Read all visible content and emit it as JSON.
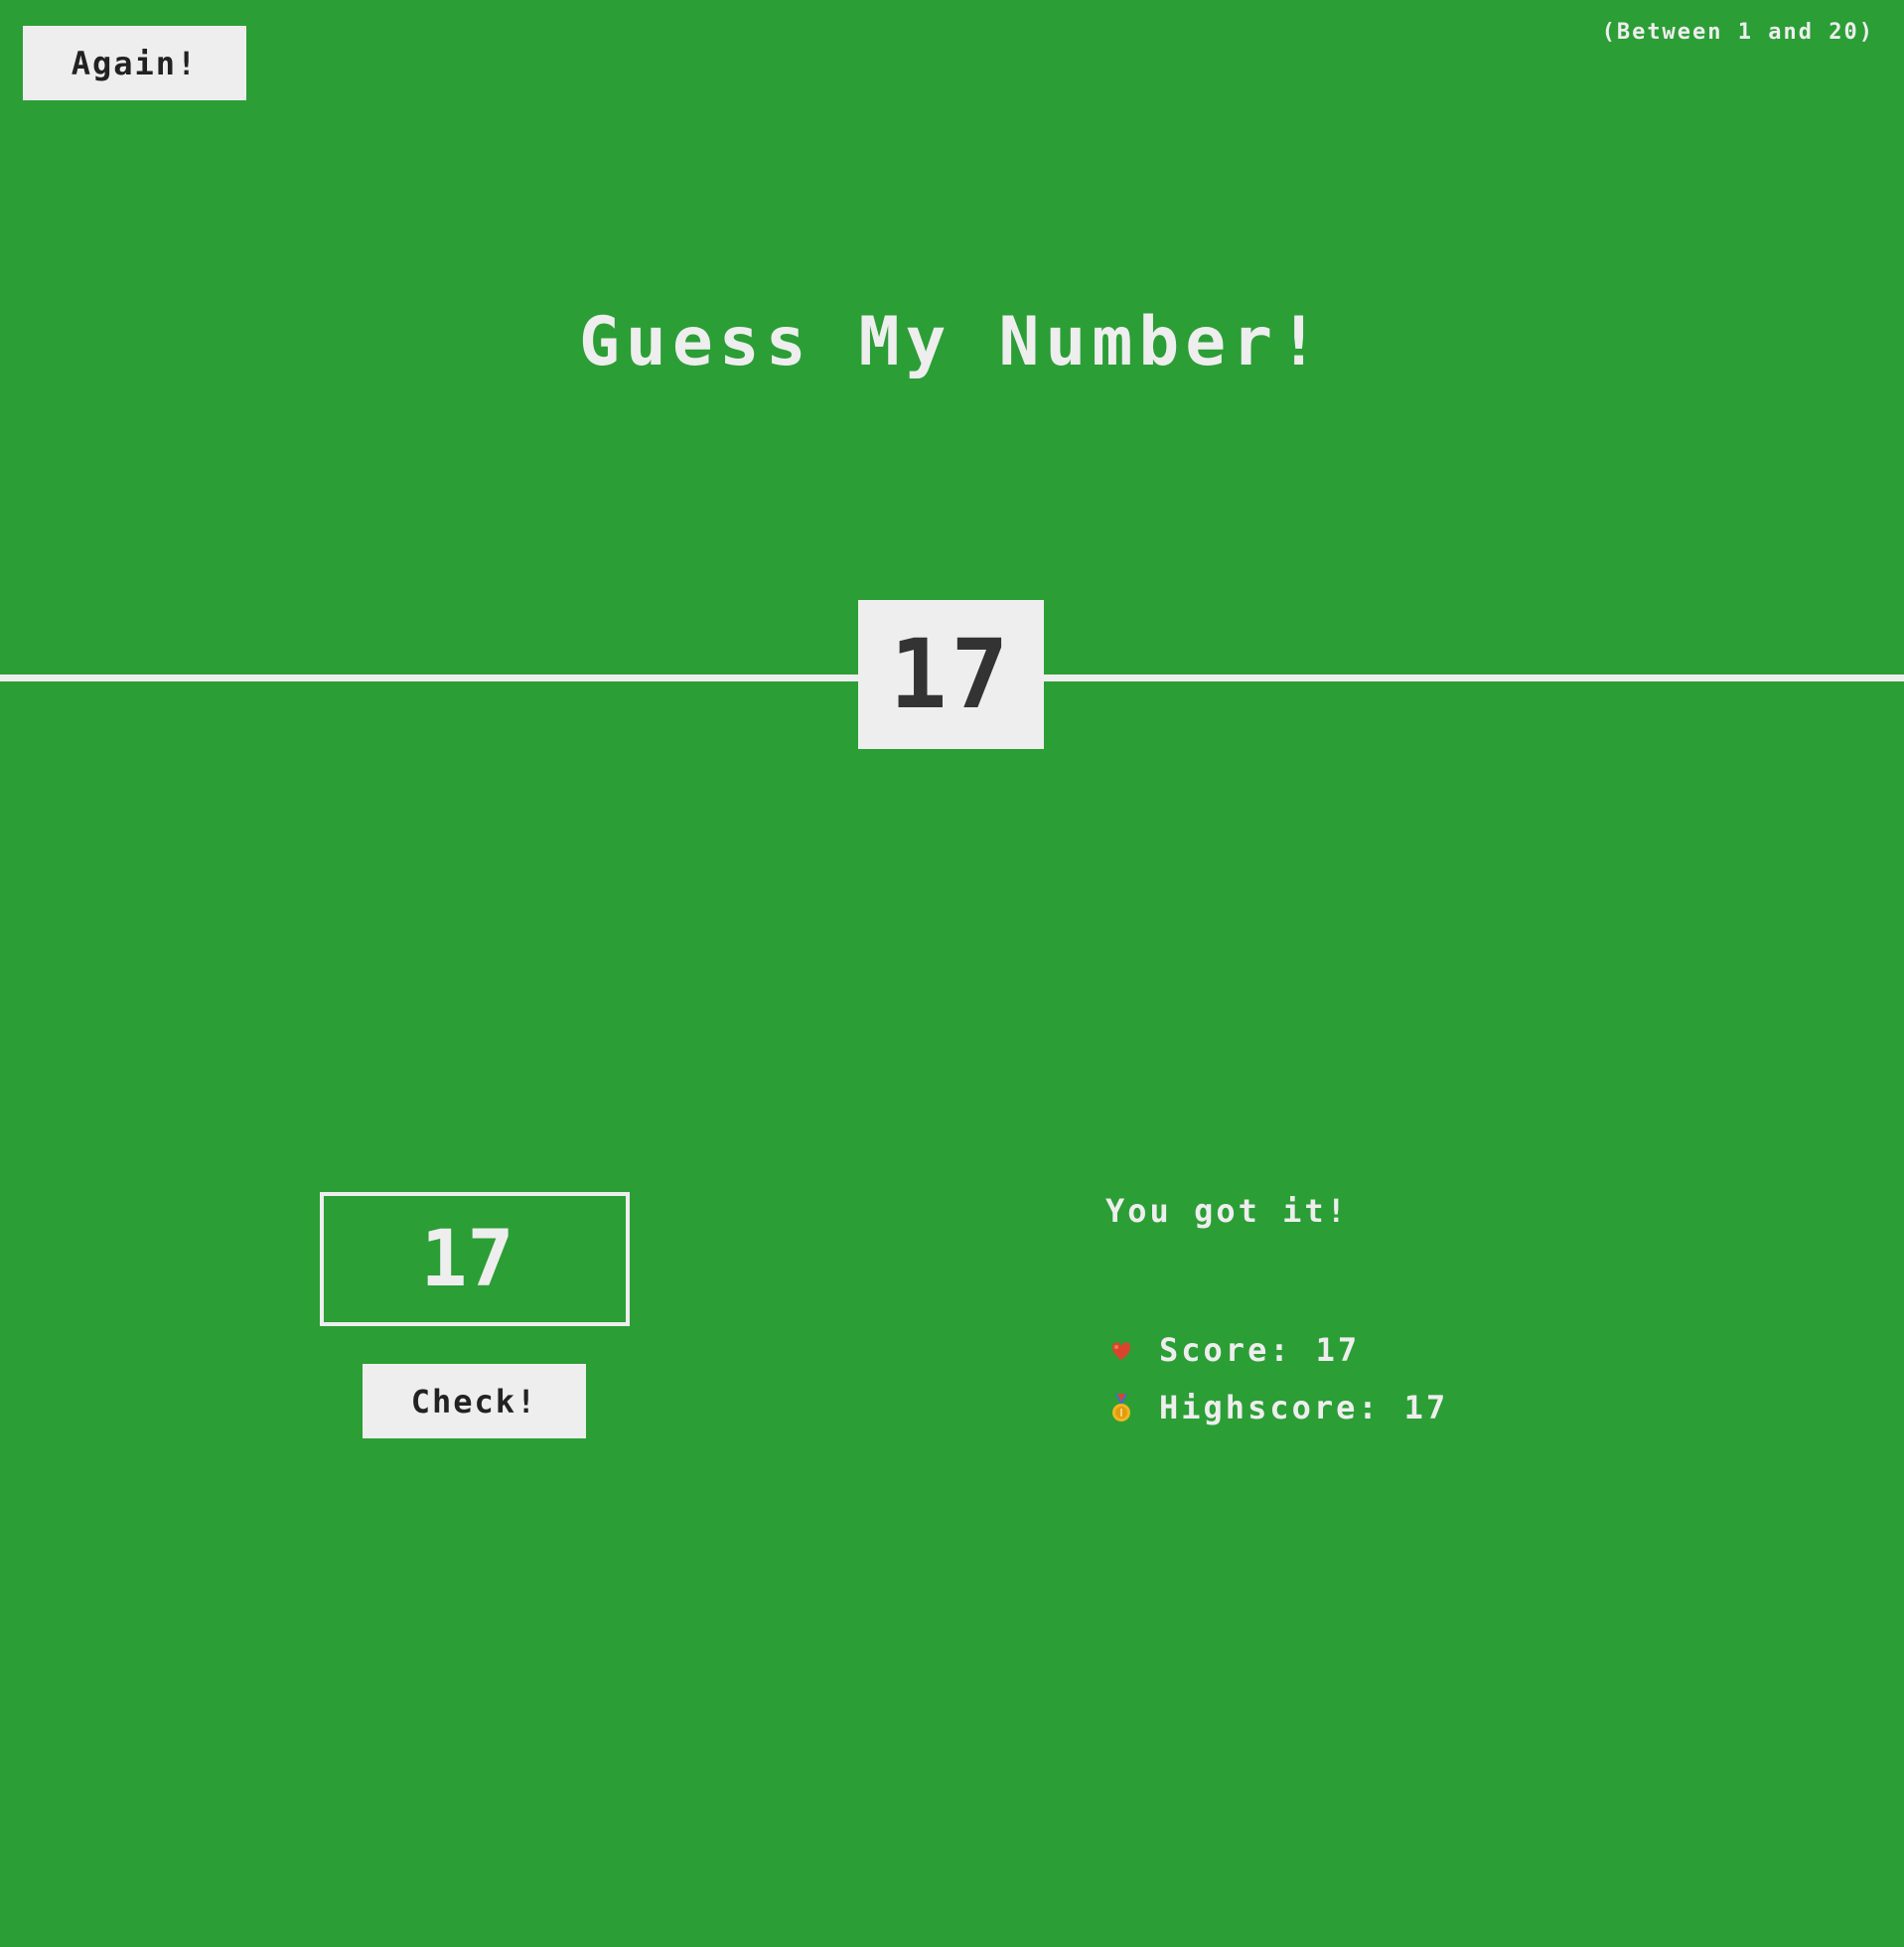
{
  "header": {
    "again_label": "Again!",
    "range_text": "(Between 1 and 20)"
  },
  "title": "Guess My Number!",
  "secret_number": "17",
  "guess": {
    "value": "17"
  },
  "check_label": "Check!",
  "message": "You got it!",
  "stats": {
    "score_label": "Score:",
    "score_value": "17",
    "score_icon": "score-icon",
    "highscore_label": "Highscore:",
    "highscore_value": "17",
    "highscore_icon": "medal-icon"
  },
  "colors": {
    "background": "#2b9e36",
    "foreground": "#eeeeee",
    "number_text": "#333333"
  }
}
